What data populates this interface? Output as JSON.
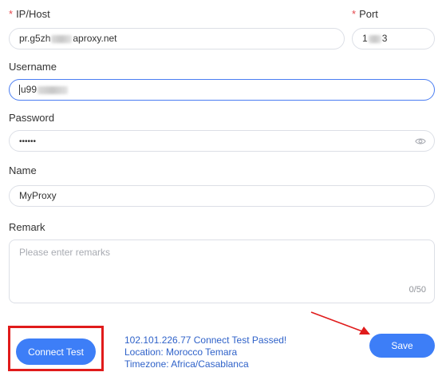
{
  "form": {
    "ip_host": {
      "label": "IP/Host",
      "required_mark": "*",
      "value_start": "pr.g5zh",
      "value_end": "aproxy.net"
    },
    "port": {
      "label": "Port",
      "required_mark": "*",
      "value_start": "1",
      "value_end": "3"
    },
    "username": {
      "label": "Username",
      "value_start": "u99"
    },
    "password": {
      "label": "Password",
      "value": "••••••"
    },
    "name": {
      "label": "Name",
      "value": "MyProxy"
    },
    "remark": {
      "label": "Remark",
      "placeholder": "Please enter remarks",
      "counter": "0/50"
    }
  },
  "actions": {
    "connect_test": "Connect Test",
    "save": "Save"
  },
  "test_result": {
    "line1": "102.101.226.77 Connect Test Passed!",
    "line2": "Location: Morocco Temara",
    "line3": "Timezone: Africa/Casablanca"
  },
  "colors": {
    "accent": "#3d7ef7",
    "result_text": "#2f62c9",
    "annotation": "#e01b1b",
    "required": "#e5484d"
  },
  "icons": {
    "password_toggle": "eye-icon",
    "annotation_arrow": "arrow-icon"
  }
}
